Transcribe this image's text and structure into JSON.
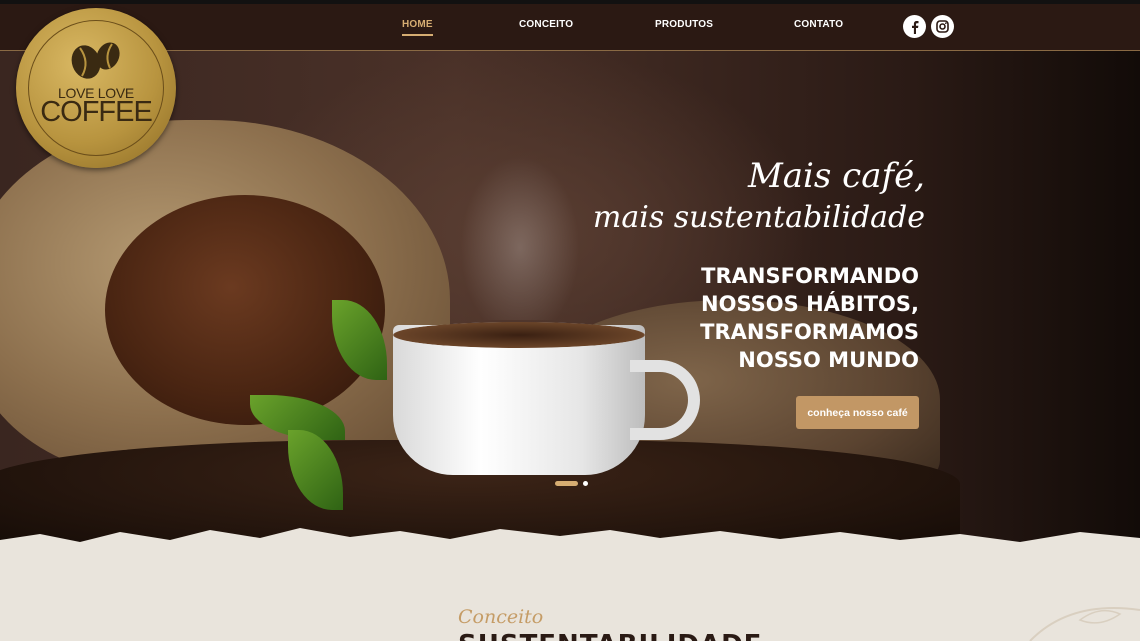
{
  "logo": {
    "line1": "LOVE LOVE",
    "line2": "COFFEE",
    "ring_text": "LOVE LOVE COFFEE"
  },
  "nav": {
    "items": [
      {
        "label": "HOME",
        "active": true
      },
      {
        "label": "CONCEITO",
        "active": false
      },
      {
        "label": "PRODUTOS",
        "active": false
      },
      {
        "label": "CONTATO",
        "active": false
      }
    ],
    "social": [
      {
        "icon": "facebook-icon"
      },
      {
        "icon": "instagram-icon"
      }
    ]
  },
  "hero": {
    "script_line1": "Mais café,",
    "script_line2": "mais sustentabilidade",
    "headline": [
      "TRANSFORMANDO",
      "NOSSOS HÁBITOS,",
      "TRANSFORMAMOS",
      "NOSSO MUNDO"
    ],
    "cta_label": "conheça nosso café",
    "slider": {
      "slides": 2,
      "active_index": 0
    }
  },
  "section": {
    "label": "Conceito",
    "title": "SUSTENTABILIDADE"
  },
  "colors": {
    "accent_gold": "#d6ad72",
    "cta_bg": "#c29765",
    "navbar_bg": "#2b1913",
    "page_bg": "#e9e4dc"
  }
}
